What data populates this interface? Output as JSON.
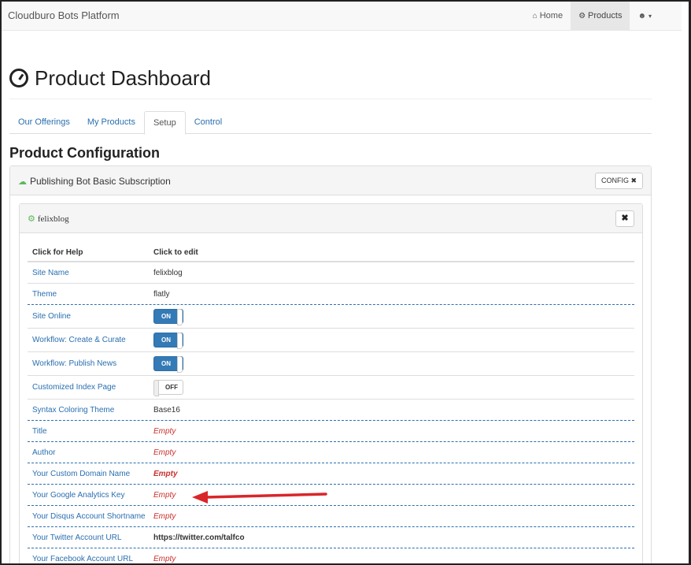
{
  "navbar": {
    "brand": "Cloudburo Bots Platform",
    "items": [
      {
        "label": "Home",
        "icon": "home-icon"
      },
      {
        "label": "Products",
        "icon": "gear-icon"
      },
      {
        "label": "",
        "icon": "user-icon"
      }
    ]
  },
  "page": {
    "title": "Product Dashboard",
    "icon": "dashboard-icon"
  },
  "tabs": [
    "Our Offerings",
    "My Products",
    "Setup",
    "Control"
  ],
  "active_tab": "Setup",
  "section_title": "Product Configuration",
  "panel": {
    "title": "Publishing Bot Basic Subscription",
    "config_label": "CONFIG ✖"
  },
  "inner": {
    "title": "felixblog",
    "close_label": "✖"
  },
  "table": {
    "col_help": "Click for Help",
    "col_edit": "Click to edit",
    "rows": [
      {
        "label": "Site Name",
        "value": "felixblog"
      },
      {
        "label": "Theme",
        "value": "flatly"
      },
      {
        "label": "Site Online",
        "value": "ON"
      },
      {
        "label": "Workflow: Create & Curate",
        "value": "ON"
      },
      {
        "label": "Workflow: Publish News",
        "value": "ON"
      },
      {
        "label": "Customized Index Page",
        "value": "OFF"
      },
      {
        "label": "Syntax Coloring Theme",
        "value": "Base16"
      },
      {
        "label": "Title",
        "value": "Empty"
      },
      {
        "label": "Author",
        "value": "Empty"
      },
      {
        "label": "Your Custom Domain Name",
        "value": "Empty"
      },
      {
        "label": "Your Google Analytics Key",
        "value": "Empty"
      },
      {
        "label": "Your Disqus Account Shortname",
        "value": "Empty"
      },
      {
        "label": "Your Twitter Account URL",
        "value": "https://twitter.com/talfco"
      },
      {
        "label": "Your Facebook Account URL",
        "value": "Empty"
      }
    ]
  },
  "colors": {
    "link": "#2a6fb0",
    "empty": "#c9302c",
    "toggle_on": "#337ab7",
    "cloud": "#5cb85c",
    "arrow": "#d9262a"
  }
}
